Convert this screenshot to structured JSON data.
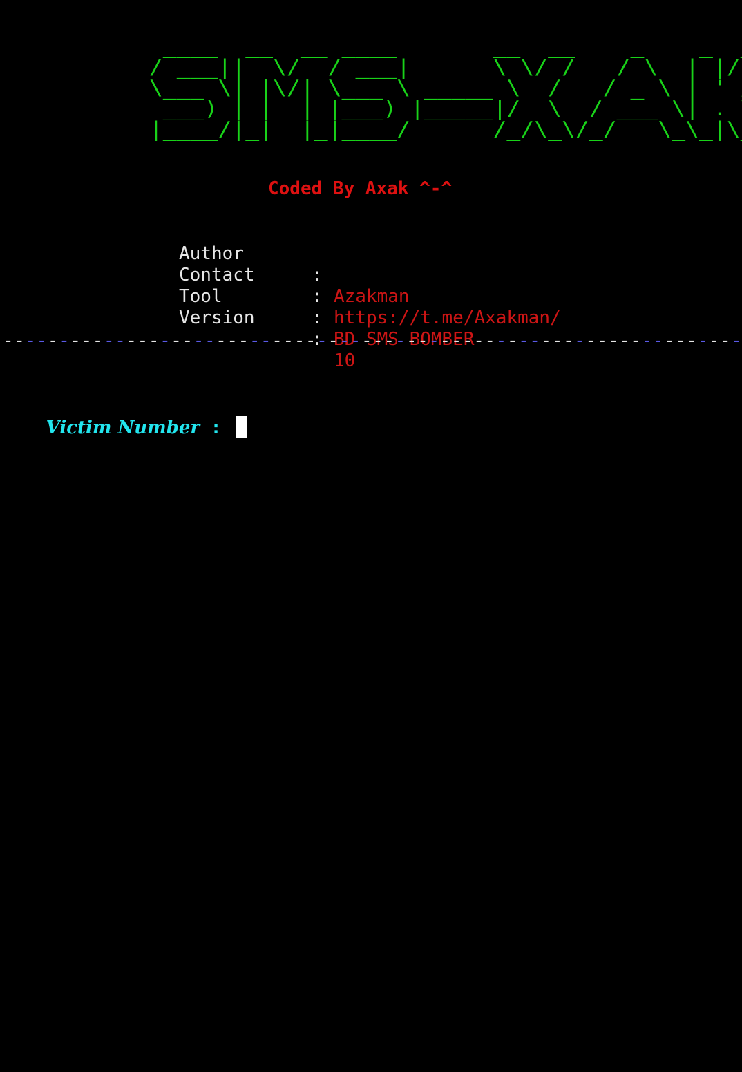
{
  "banner": {
    "ascii": "  ____  __  __ ____       __  __    _    _  __\n / ___||  \\/  / ___|      \\ \\/ /   / \\  | |/ /\n \\___ \\| |\\/| \\___ \\ _____ \\  /   / _ \\ | ' / \n  ___) | |  | |___) |_____|/  \\  / ___ \\| . \\ \n |____/|_|  |_|____/      /_/\\_\\/_/   \\_\\_|\\_\\",
    "color": "#19d219"
  },
  "coded_by": "Coded By Axak ^-^",
  "info": [
    {
      "key": "Author",
      "colon": ":",
      "value": "Azakman"
    },
    {
      "key": "Contact",
      "colon": ":",
      "value": "https://t.me/Axakman/"
    },
    {
      "key": "Tool",
      "colon": ":",
      "value": "BD SMS BOMBER"
    },
    {
      "key": "Version",
      "colon": ":",
      "value": "10"
    }
  ],
  "divider": {
    "pattern": "--------------------------------------------------------------------",
    "colors": [
      "#e6e6e6",
      "#5a5ae6"
    ]
  },
  "prompt": {
    "label": "Victim Number",
    "colon": " : ",
    "value": ""
  },
  "colors": {
    "background": "#000000",
    "banner": "#19d219",
    "accent_red": "#dd1111",
    "value_red": "#cc1515",
    "prompt_cyan": "#22e5ee"
  }
}
